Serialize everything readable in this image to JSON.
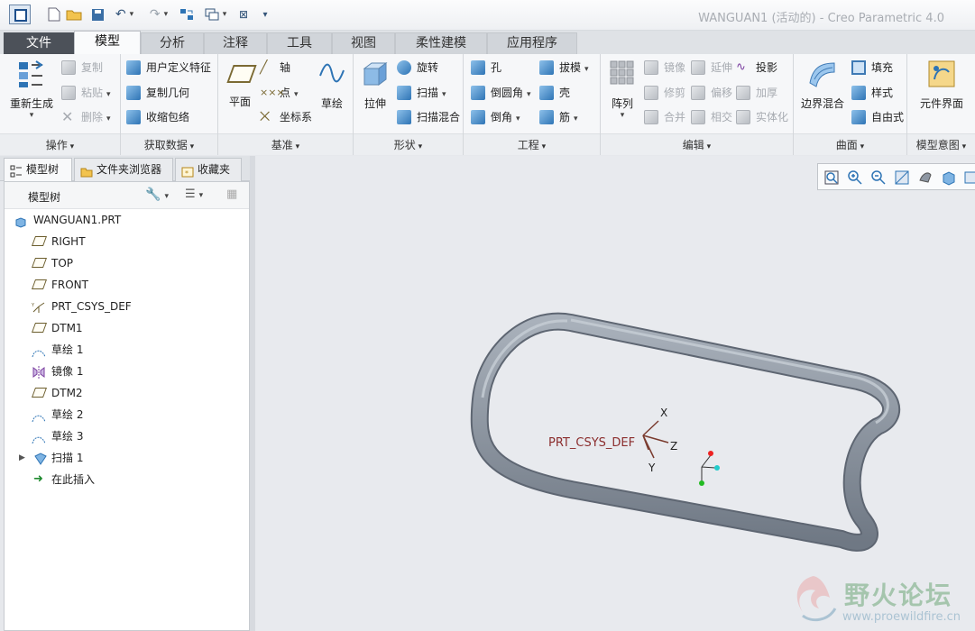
{
  "window": {
    "title": "WANGUAN1 (活动的) - Creo Parametric 4.0"
  },
  "ribbon_tabs": [
    "文件",
    "模型",
    "分析",
    "注释",
    "工具",
    "视图",
    "柔性建模",
    "应用程序"
  ],
  "groups": {
    "operations": {
      "label": "操作",
      "regenerate": "重新生成",
      "copy": "复制",
      "paste": "粘贴",
      "delete": "删除"
    },
    "get_data": {
      "label": "获取数据",
      "udf": "用户定义特征",
      "copy_geom": "复制几何",
      "shrinkwrap": "收缩包络"
    },
    "datum": {
      "label": "基准",
      "plane": "平面",
      "axis": "轴",
      "point": "点",
      "csys": "坐标系",
      "sketch": "草绘"
    },
    "shapes": {
      "label": "形状",
      "extrude": "拉伸",
      "revolve": "旋转",
      "sweep": "扫描",
      "swept_blend": "扫描混合"
    },
    "engineering": {
      "label": "工程",
      "hole": "孔",
      "round": "倒圆角",
      "chamfer": "倒角",
      "draft": "拔模",
      "shell": "壳",
      "rib": "筋"
    },
    "editing": {
      "label": "编辑",
      "pattern": "阵列",
      "mirror": "镜像",
      "trim": "修剪",
      "merge": "合并",
      "extend": "延伸",
      "offset": "偏移",
      "intersect": "相交",
      "project": "投影",
      "thicken": "加厚",
      "solidify": "实体化"
    },
    "surfaces": {
      "label": "曲面",
      "boundary_blend": "边界混合",
      "fill": "填充",
      "style": "样式",
      "freestyle": "自由式"
    },
    "model_intent": {
      "label": "模型意图",
      "component_interface": "元件界面"
    }
  },
  "panel_tabs": [
    "模型树",
    "文件夹浏览器",
    "收藏夹"
  ],
  "tree": {
    "header": "模型树",
    "items": [
      {
        "label": "WANGUAN1.PRT",
        "icon": "part-icon"
      },
      {
        "label": "RIGHT",
        "icon": "datum-plane-icon"
      },
      {
        "label": "TOP",
        "icon": "datum-plane-icon"
      },
      {
        "label": "FRONT",
        "icon": "datum-plane-icon"
      },
      {
        "label": "PRT_CSYS_DEF",
        "icon": "csys-icon"
      },
      {
        "label": "DTM1",
        "icon": "datum-plane-icon"
      },
      {
        "label": "草绘 1",
        "icon": "sketch-icon"
      },
      {
        "label": "镜像 1",
        "icon": "mirror-icon"
      },
      {
        "label": "DTM2",
        "icon": "datum-plane-icon"
      },
      {
        "label": "草绘 2",
        "icon": "sketch-icon"
      },
      {
        "label": "草绘 3",
        "icon": "sketch-icon"
      },
      {
        "label": "扫描 1",
        "icon": "sweep-icon"
      },
      {
        "label": "在此插入",
        "icon": "insert-here-icon"
      }
    ]
  },
  "graphics": {
    "csys_label": "PRT_CSYS_DEF",
    "axes": {
      "x": "X",
      "y": "Y",
      "z": "Z"
    }
  },
  "watermark": {
    "title": "野火论坛",
    "url": "www.proewildfire.cn"
  },
  "colors": {
    "file_tab": "#4c5159",
    "model_color": "#8e97a3",
    "csys_label": "#8b2d2d"
  }
}
